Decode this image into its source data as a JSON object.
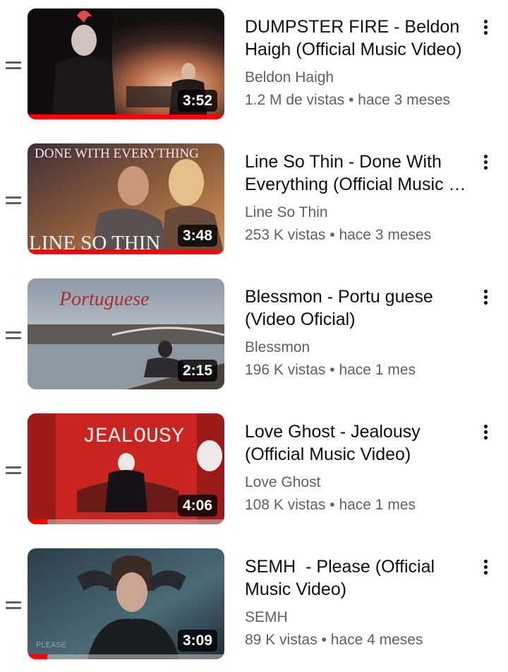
{
  "videos": [
    {
      "title": "DUMPSTER FIRE - Beldon Haigh (Official Music Video)",
      "channel": "Beldon Haigh",
      "views": "1.2 M de vistas",
      "age": "hace 3 meses",
      "duration": "3:52",
      "watched_fraction": 1.0,
      "thumb_icon": "dark-performance-scene-thumbnail"
    },
    {
      "title": "Line So Thin - Done With Everything (Official Music Video)",
      "channel": "Line So Thin",
      "views": "253 K vistas",
      "age": "hace 3 meses",
      "duration": "3:48",
      "watched_fraction": 1.0,
      "thumb_text_top": "DONE WITH EVERYTHING",
      "thumb_text_bottom": "LINE SO THIN",
      "thumb_icon": "couple-portrait-thumbnail"
    },
    {
      "title": "Blessmon - Portu guese (Video Oficial)",
      "channel": "Blessmon",
      "views": "196 K vistas",
      "age": "hace 1 mes",
      "duration": "2:15",
      "watched_fraction": 0.0,
      "thumb_text_top": "Portuguese",
      "thumb_icon": "river-bridge-thumbnail"
    },
    {
      "title": "Love Ghost - Jealousy (Official Music Video)",
      "channel": "Love Ghost",
      "views": "108 K vistas",
      "age": "hace 1 mes",
      "duration": "4:06",
      "watched_fraction": 0.1,
      "thumb_text_top": "JEALOUSY",
      "thumb_icon": "red-room-thumbnail"
    },
    {
      "title": "SEMH  - Please (Official Music Video)",
      "channel": "SEMH",
      "views": "89 K vistas",
      "age": "hace 4 meses",
      "duration": "3:09",
      "watched_fraction": 0.1,
      "thumb_text_bottom": "PLEASE",
      "thumb_icon": "woman-portrait-thumbnail"
    }
  ],
  "separator": " • ",
  "colors": {
    "progress": "#ff0000",
    "title_text": "#0f0f0f",
    "secondary_text": "#606060"
  },
  "icons": {
    "drag_handle": "drag-handle-icon",
    "menu": "more-vert-icon"
  }
}
